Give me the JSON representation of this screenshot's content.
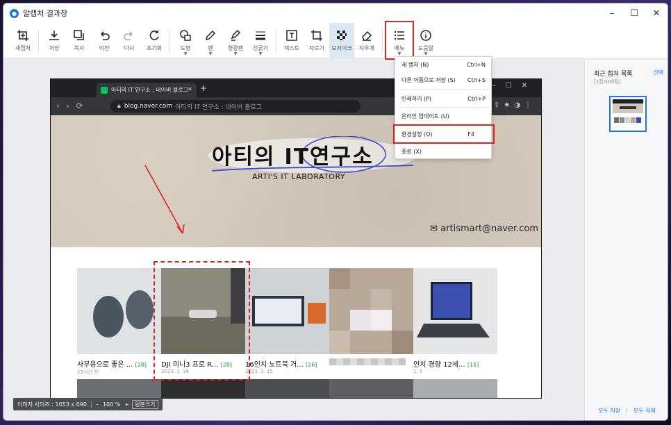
{
  "window": {
    "title": "알캡처 결과창",
    "controls": [
      "–",
      "☐",
      "✕"
    ]
  },
  "toolbar": {
    "tools": [
      {
        "id": "new-capture",
        "label": "새캡처"
      },
      {
        "id": "save",
        "label": "저장"
      },
      {
        "id": "copy",
        "label": "복사"
      },
      {
        "id": "undo",
        "label": "이전"
      },
      {
        "id": "redo",
        "label": "다시"
      },
      {
        "id": "reset",
        "label": "초기화"
      },
      {
        "id": "shape",
        "label": "도형"
      },
      {
        "id": "pen",
        "label": "펜"
      },
      {
        "id": "highlighter",
        "label": "형광펜"
      },
      {
        "id": "line-thickness",
        "label": "선굵기"
      },
      {
        "id": "text",
        "label": "텍스트"
      },
      {
        "id": "crop",
        "label": "자르기"
      },
      {
        "id": "mosaic",
        "label": "모자이크"
      },
      {
        "id": "eraser",
        "label": "지우개"
      },
      {
        "id": "menu",
        "label": "메뉴"
      },
      {
        "id": "help",
        "label": "도움말"
      }
    ]
  },
  "menu": {
    "items": [
      {
        "label": "새 캡처 (N)",
        "shortcut": "Ctrl+N"
      },
      {
        "label": "다른 이름으로 저장 (S)",
        "shortcut": "Ctrl+S"
      },
      {
        "label": "인쇄하기 (P)",
        "shortcut": "Ctrl+P"
      },
      {
        "label": "온라인 업데이트 (U)",
        "shortcut": ""
      },
      {
        "label": "환경설정 (O)",
        "shortcut": "F4"
      },
      {
        "label": "종료 (X)",
        "shortcut": ""
      }
    ]
  },
  "captured": {
    "tab_title": "아티의 IT 연구소 : 네이버 블로그",
    "url_host": "blog.naver.com",
    "url_rest": "아티의 IT 연구소 : 네이버 블로그",
    "brand_title": "아티의 IT연구소",
    "brand_subtitle": "ARTI'S IT LABORATORY",
    "email": "artismart@naver.com",
    "posts": [
      {
        "caption": "사무용으로 좋은 ...",
        "count": "[28]",
        "date": "23시간 전"
      },
      {
        "caption": "DJI 미니3 프로 R...",
        "count": "[28]",
        "date": "2023. 1. 16"
      },
      {
        "caption": "16인치 노트북 거...",
        "count": "[26]",
        "date": "2023. 1. 15"
      },
      {
        "caption": "",
        "count": "",
        "date": ""
      },
      {
        "caption": "인치 경량 12세...",
        "count": "[15]",
        "date": "1. 5"
      }
    ]
  },
  "statusbar": {
    "image_size": "이미지 사이즈 : 1053 x 690",
    "zoom_minus": "–",
    "zoom": "100 %",
    "zoom_plus": "+",
    "fit": "원본크기"
  },
  "sidepanel": {
    "title": "최근 캡처 목록",
    "select": "선택",
    "count": "[1장/100장]",
    "save_all": "모두 저장",
    "delete_all": "모두 삭제"
  },
  "colors": {
    "accent": "#1b74e4",
    "annotation_red": "#e02020",
    "naver_green": "#03c75a"
  }
}
